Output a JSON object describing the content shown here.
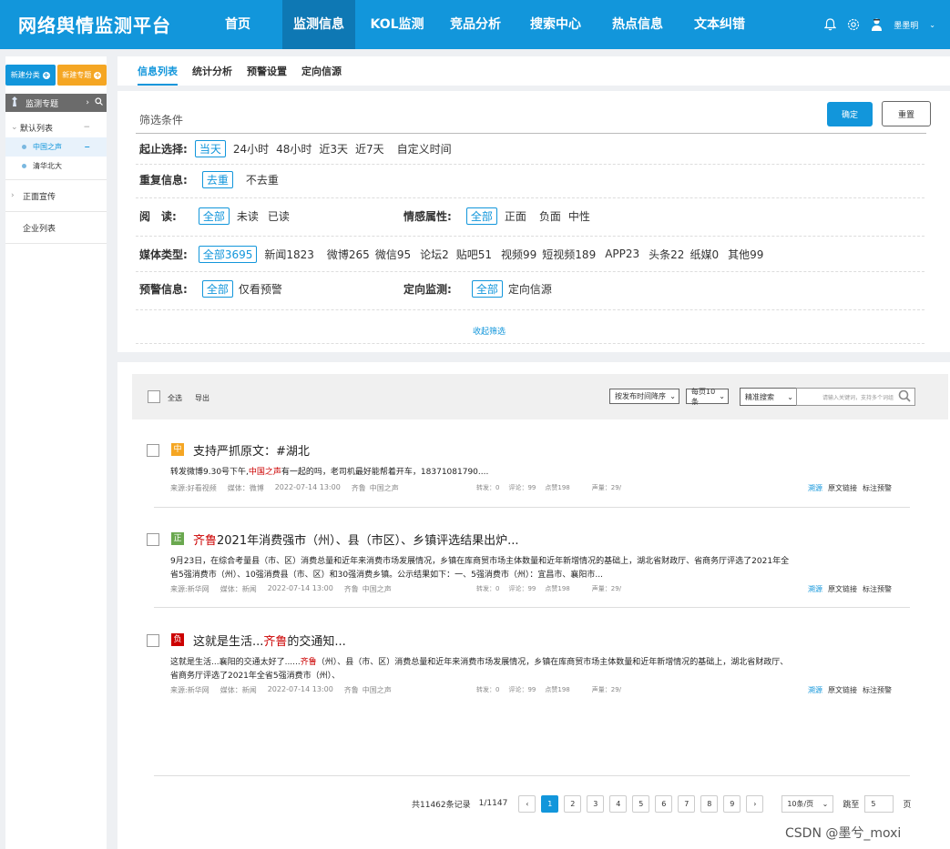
{
  "app": {
    "title": "网络舆情监测平台",
    "user": "墨墨明"
  },
  "nav": {
    "items": [
      {
        "label": "首页",
        "active": false
      },
      {
        "label": "监测信息",
        "active": true
      },
      {
        "label": "KOL监测",
        "active": false
      },
      {
        "label": "竞品分析",
        "active": false
      },
      {
        "label": "搜索中心",
        "active": false
      },
      {
        "label": "热点信息",
        "active": false
      },
      {
        "label": "文本纠错",
        "active": false
      }
    ]
  },
  "sidebar": {
    "new_category": "新建分类",
    "new_topic": "新建专题",
    "section_label": "监测专题",
    "default_list": "默认列表",
    "children": [
      "中国之声",
      "清华北大"
    ],
    "positive_publicity": "正面宣传",
    "enterprise_list": "企业列表"
  },
  "tabs": [
    "信息列表",
    "统计分析",
    "预警设置",
    "定向信源"
  ],
  "filter": {
    "title": "筛选条件",
    "confirm": "确定",
    "reset": "重置",
    "collapse": "收起筛选",
    "time": {
      "label": "起止选择:",
      "options": [
        "当天",
        "24小时",
        "48小时",
        "近3天",
        "近7天",
        "自定义时间"
      ]
    },
    "dup": {
      "label": "重复信息:",
      "options": [
        "去重",
        "不去重"
      ]
    },
    "read": {
      "label": "阅　读:",
      "options": [
        "全部",
        "未读",
        "已读"
      ]
    },
    "sentiment": {
      "label": "情感属性:",
      "options": [
        "全部",
        "正面",
        "负面",
        "中性"
      ]
    },
    "media": {
      "label": "媒体类型:",
      "options": [
        "全部3695",
        "新闻1823",
        "微博265",
        "微信95",
        "论坛2",
        "贴吧51",
        "视频99",
        "短视频189",
        "APP23",
        "头条22",
        "纸媒0",
        "其他99"
      ]
    },
    "alert": {
      "label": "预警信息:",
      "options": [
        "全部",
        "仅看预警"
      ]
    },
    "directed": {
      "label": "定向监测:",
      "options": [
        "全部",
        "定向信源"
      ]
    }
  },
  "toolbar": {
    "select_all": "全选",
    "export": "导出",
    "sort": "按发布时间降序",
    "per_page": "每页10条",
    "search_mode": "精准搜索",
    "search_placeholder": "请输入关键词，支持多个词组"
  },
  "items": [
    {
      "badge": "中",
      "badge_color": "#f5a623",
      "title_hl": "",
      "title": "支持严抓原文：#湖北",
      "sum_pre": "转发微博9.30号下午,",
      "sum_hl": "中国之声",
      "sum_post": "有一起的吗，老司机最好能帮着开车，18371081790....",
      "source": "来源:好看视频",
      "media": "媒体：微博",
      "time": "2022-07-14 13:00",
      "tag1": "齐鲁",
      "tag2": "中国之声",
      "forward": "转发：0",
      "comment": "评论：99",
      "likes": "点赞198",
      "volume": "声量：29/",
      "act1": "溯源",
      "act2": "原文链接",
      "act3": "标注预警"
    },
    {
      "badge": "正",
      "badge_color": "#6aa84f",
      "title_hl": "齐鲁",
      "title": "2021年消费强市（州）、县（市区）、乡镇评选结果出炉...",
      "sum_pre": "9月23日，在综合考量县（市、区）消费总量和近年来消费市场发展情况，乡镇在库商贸市场主体数量和近年新增情况的基础上，湖北省财政厅、省商务厅评选了2021年全省5强消费市（州）、10强消费县（市、区）和30强消费乡镇。公示结果如下：一、5强消费市（州）：宜昌市、襄阳市...",
      "sum_hl": "",
      "sum_post": "",
      "source": "来源:新华网",
      "media": "媒体：新闻",
      "time": "2022-07-14 13:00",
      "tag1": "齐鲁",
      "tag2": "中国之声",
      "forward": "转发：0",
      "comment": "评论：99",
      "likes": "点赞198",
      "volume": "声量：29/",
      "act1": "溯源",
      "act2": "原文链接",
      "act3": "标注预警"
    },
    {
      "badge": "负",
      "badge_color": "#cc0000",
      "title_hl": "齐鲁",
      "title_pre": "这就是生活...",
      "title": "的交通知...",
      "sum_pre": "这就是生活...襄阳的交通太好了......",
      "sum_hl": "齐鲁",
      "sum_post": "（州）、县（市、区）消费总量和近年来消费市场发展情况，乡镇在库商贸市场主体数量和近年新增情况的基础上，湖北省财政厅、省商务厅评选了2021年全省5强消费市（州）、",
      "source": "来源:新华网",
      "media": "媒体：新闻",
      "time": "2022-07-14 13:00",
      "tag1": "齐鲁",
      "tag2": "中国之声",
      "forward": "转发：0",
      "comment": "评论：99",
      "likes": "点赞198",
      "volume": "声量：29/",
      "act1": "溯源",
      "act2": "原文链接",
      "act3": "标注预警"
    }
  ],
  "pager": {
    "total": "共11462条记录",
    "pages": "1/1147",
    "prev": "‹",
    "next": "›",
    "numbers": [
      "1",
      "2",
      "3",
      "4",
      "5",
      "6",
      "7",
      "8",
      "9"
    ],
    "current": "1",
    "size": "10条/页",
    "jump_label": "跳至",
    "jump_value": "5",
    "page_unit": "页"
  },
  "watermark": "CSDN @墨兮_moxi",
  "colors": {
    "primary": "#1296db",
    "nav_active": "#0e78b4",
    "orange": "#f5a623",
    "highlight": "#cc0000"
  }
}
